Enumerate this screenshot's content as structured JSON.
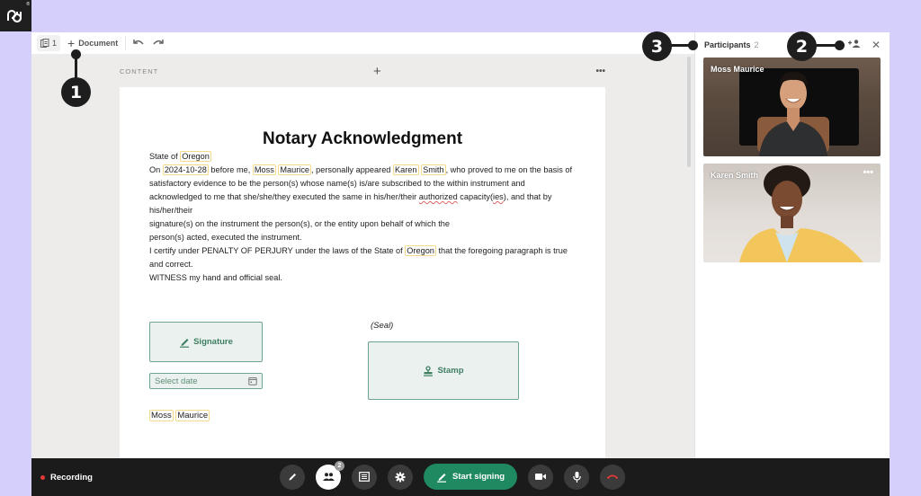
{
  "logo": {
    "text": "pd",
    "mark": "®"
  },
  "toolbar": {
    "pages_count": "1",
    "add_document_label": "Document",
    "undo_icon": "undo-icon",
    "redo_icon": "redo-icon"
  },
  "content_bar": {
    "label": "CONTENT",
    "add_icon": "+",
    "more_icon": "•••"
  },
  "document": {
    "title": "Notary Acknowledgment",
    "state_prefix": "State of ",
    "state": "Oregon",
    "para1": {
      "t1": "On ",
      "date": "2024-10-28",
      "t2": " before me, ",
      "notary_first": "Moss",
      "notary_last": "Maurice",
      "t3": ",  personally appeared ",
      "signer_first": "Karen",
      "signer_last": "Smith",
      "t4": ", who proved to me on the basis of satisfactory evidence to be the person(s) whose name(s) is/are subscribed to the within instrument and acknowledged to me that she/she/they executed the same in his/her/their ",
      "authorized": "authorized",
      "t5": " capacity(",
      "ies": "ies",
      "t6": "), and that by his/her/their",
      "line2": "signature(s) on the instrument the person(s), or the entity upon behalf of which the",
      "line3": "person(s) acted, executed the instrument."
    },
    "para2": {
      "t1": "I certify under PENALTY OF PERJURY under the laws of the State of ",
      "state": "Oregon",
      "t2": " that the foregoing paragraph is true and correct."
    },
    "witness": "WITNESS my hand and official seal.",
    "signature_label": "Signature",
    "date_placeholder": "Select date",
    "seal_label": "(Seal)",
    "stamp_label": "Stamp",
    "signer_first": "Moss",
    "signer_last": "Maurice"
  },
  "participants": {
    "title": "Participants",
    "count": "2",
    "list": [
      {
        "name": "Moss Maurice"
      },
      {
        "name": "Karen Smith",
        "menu": "•••"
      }
    ]
  },
  "bottom_bar": {
    "recording_label": "Recording",
    "participants_badge": "2",
    "start_signing_label": "Start signing"
  },
  "callouts": [
    "1",
    "2",
    "3"
  ],
  "colors": {
    "accent_green": "#1f8a61",
    "field_border": "#6ea58c",
    "tag_border": "#f3d98b",
    "background": "#d5d0fb",
    "recording_red": "#e53935"
  }
}
